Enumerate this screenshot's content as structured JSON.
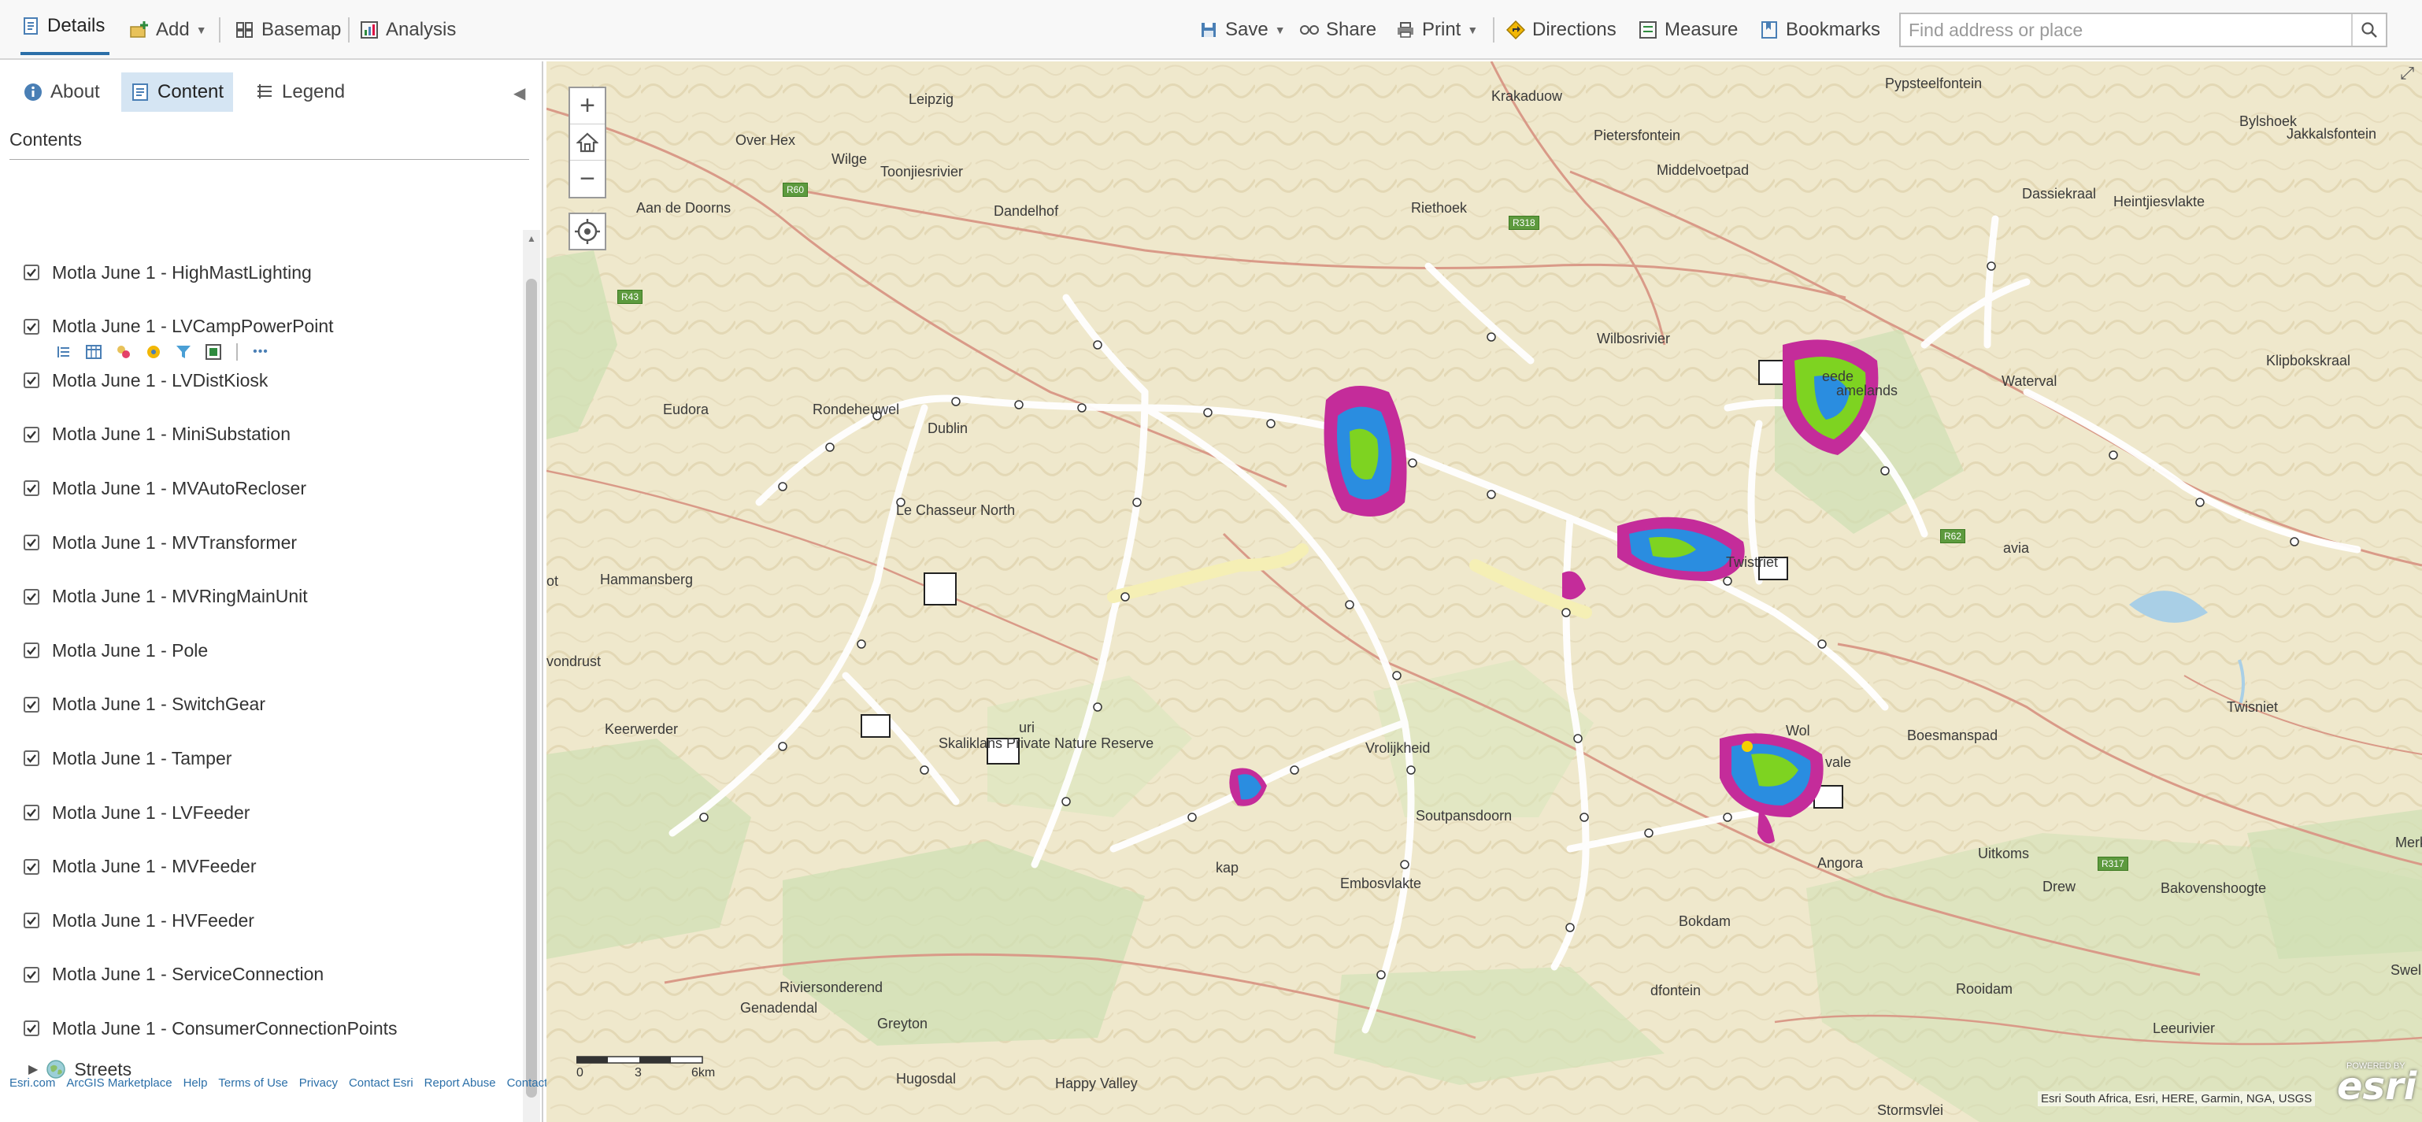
{
  "toolbar": {
    "details": "Details",
    "add": "Add",
    "basemap": "Basemap",
    "analysis": "Analysis",
    "save": "Save",
    "share": "Share",
    "print": "Print",
    "directions": "Directions",
    "measure": "Measure",
    "bookmarks": "Bookmarks",
    "search_placeholder": "Find address or place"
  },
  "panel": {
    "tabs": {
      "about": "About",
      "content": "Content",
      "legend": "Legend"
    },
    "heading": "Contents",
    "layers": [
      "Motla June 1 - HighMastLighting",
      "Motla June 1 - LVCampPowerPoint",
      "Motla June 1 - LVDistKiosk",
      "Motla June 1 - MiniSubstation",
      "Motla June 1 - MVAutoRecloser",
      "Motla June 1 - MVTransformer",
      "Motla June 1 - MVRingMainUnit",
      "Motla June 1 - Pole",
      "Motla June 1 - SwitchGear",
      "Motla June 1 - Tamper",
      "Motla June 1 - LVFeeder",
      "Motla June 1 - MVFeeder",
      "Motla June 1 - HVFeeder",
      "Motla June 1 - ServiceConnection",
      "Motla June 1 - ConsumerConnectionPoints"
    ],
    "basemap_layer": "Streets",
    "more_glyph": "•••",
    "footer": [
      "Esri.com",
      "ArcGIS Marketplace",
      "Help",
      "Terms of Use",
      "Privacy",
      "Contact Esri",
      "Report Abuse",
      "Contact Us"
    ]
  },
  "map": {
    "places": [
      "Leipzig",
      "Krakaduow",
      "Pypsteelfontein",
      "Bylshoek",
      "Jakkalsfontein",
      "Over Hex",
      "Wilge",
      "Toonjiesrivier",
      "Pietersfontein",
      "Middelvoetpad",
      "Aan de Doorns",
      "Riethoek",
      "Dassiekraal",
      "Heintjiesvlakte",
      "Dandelhof",
      "Eudora",
      "Rondeheuwel",
      "Dublin",
      "Wilbosrivier",
      "Waterval",
      "Klipbokskraal",
      "Le Chasseur North",
      "Hammansberg",
      "Twistriet",
      "avia",
      "vondrust",
      "Keerwerder",
      "Skaliklans Private Nature Reserve",
      "Vrolijkheid",
      "Boesmanspad",
      "Twisniet",
      "Soutpansdoorn",
      "Uitkoms",
      "Drew",
      "Bakovenshoogte",
      "Embosvlakte",
      "Bokdam",
      "Rooidam",
      "Leeurivier",
      "Genadendal",
      "Greyton",
      "Riviersonderend",
      "Hugosdal",
      "Happy Valley",
      "Stormsvlei",
      "Swellen",
      "eede",
      "amelands",
      "Wol",
      "vale",
      "Angora",
      "dfontein",
      "kap",
      "uri",
      "ot",
      "Merk"
    ],
    "road_labels": [
      "R60",
      "R318",
      "R43",
      "R62",
      "R317"
    ],
    "zoom_in": "+",
    "zoom_out": "−",
    "scale_labels": [
      "0",
      "3",
      "6km"
    ],
    "attribution": "Esri South Africa, Esri, HERE, Garmin, NGA, USGS",
    "logo": "esri",
    "powered_by": "POWERED BY"
  },
  "colors": {
    "accent": "#2b6fa8",
    "content_tab_bg": "#d5e5f3",
    "map_bg": "#efe8cc",
    "road": "#d99a88",
    "highway": "#d78a4c",
    "hotspot_outer": "#c42c9a",
    "hotspot_mid": "#2a8de0",
    "hotspot_core": "#7ed321"
  }
}
